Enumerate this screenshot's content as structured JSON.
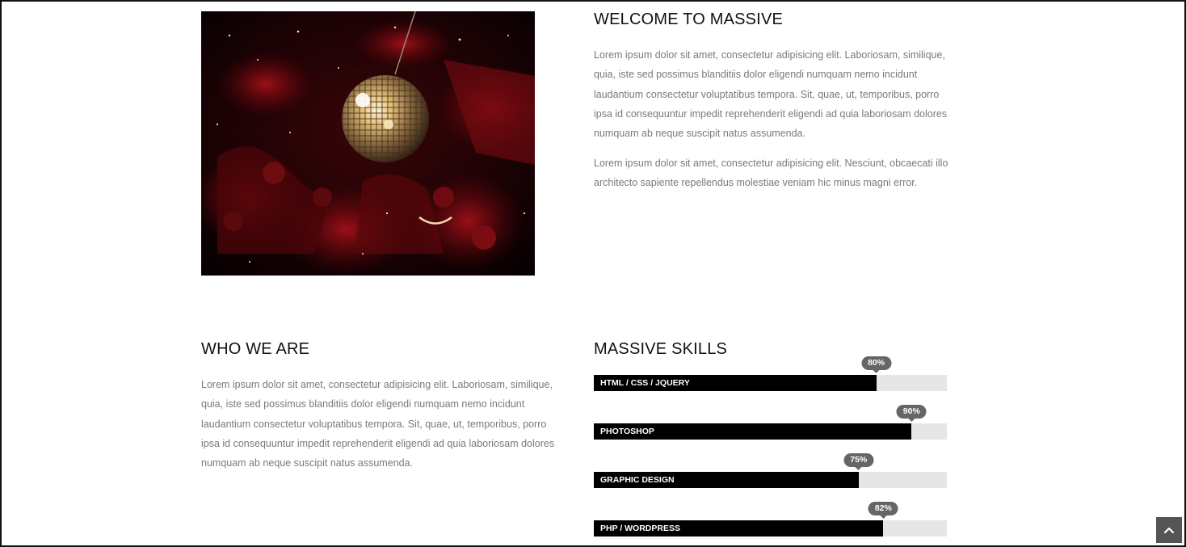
{
  "welcome": {
    "title": "WELCOME TO MASSIVE",
    "paragraph1": "Lorem ipsum dolor sit amet, consectetur adipisicing elit. Laboriosam, similique, quia, iste sed possimus blanditiis dolor eligendi numquam nemo incidunt laudantium consectetur voluptatibus tempora. Sit, quae, ut, temporibus, porro ipsa id consequuntur impedit reprehenderit eligendi ad quia laboriosam dolores numquam ab neque suscipit natus assumenda.",
    "paragraph2": "Lorem ipsum dolor sit amet, consectetur adipisicing elit. Nesciunt, obcaecati illo architecto sapiente repellendus molestiae veniam hic minus magni error."
  },
  "who_we_are": {
    "title": "WHO WE ARE",
    "paragraph": "Lorem ipsum dolor sit amet, consectetur adipisicing elit. Laboriosam, similique, quia, iste sed possimus blanditiis dolor eligendi numquam nemo incidunt laudantium consectetur voluptatibus tempora. Sit, quae, ut, temporibus, porro ipsa id consequuntur impedit reprehenderit eligendi ad quia laboriosam dolores numquam ab neque suscipit natus assumenda."
  },
  "skills": {
    "title": "MASSIVE SKILLS",
    "items": [
      {
        "label": "HTML / CSS / JQUERY",
        "percent": 80,
        "percent_label": "80%"
      },
      {
        "label": "PHOTOSHOP",
        "percent": 90,
        "percent_label": "90%"
      },
      {
        "label": "GRAPHIC DESIGN",
        "percent": 75,
        "percent_label": "75%"
      },
      {
        "label": "PHP / WORDPRESS",
        "percent": 82,
        "percent_label": "82%"
      }
    ]
  },
  "scroll_top": {
    "icon": "chevron-up-icon"
  },
  "colors": {
    "bar_fill": "#000000",
    "bar_track": "#e6e6e6",
    "badge": "#666666",
    "body_text": "#7a7a7a",
    "heading": "#111111",
    "scroll_button": "#555555"
  }
}
